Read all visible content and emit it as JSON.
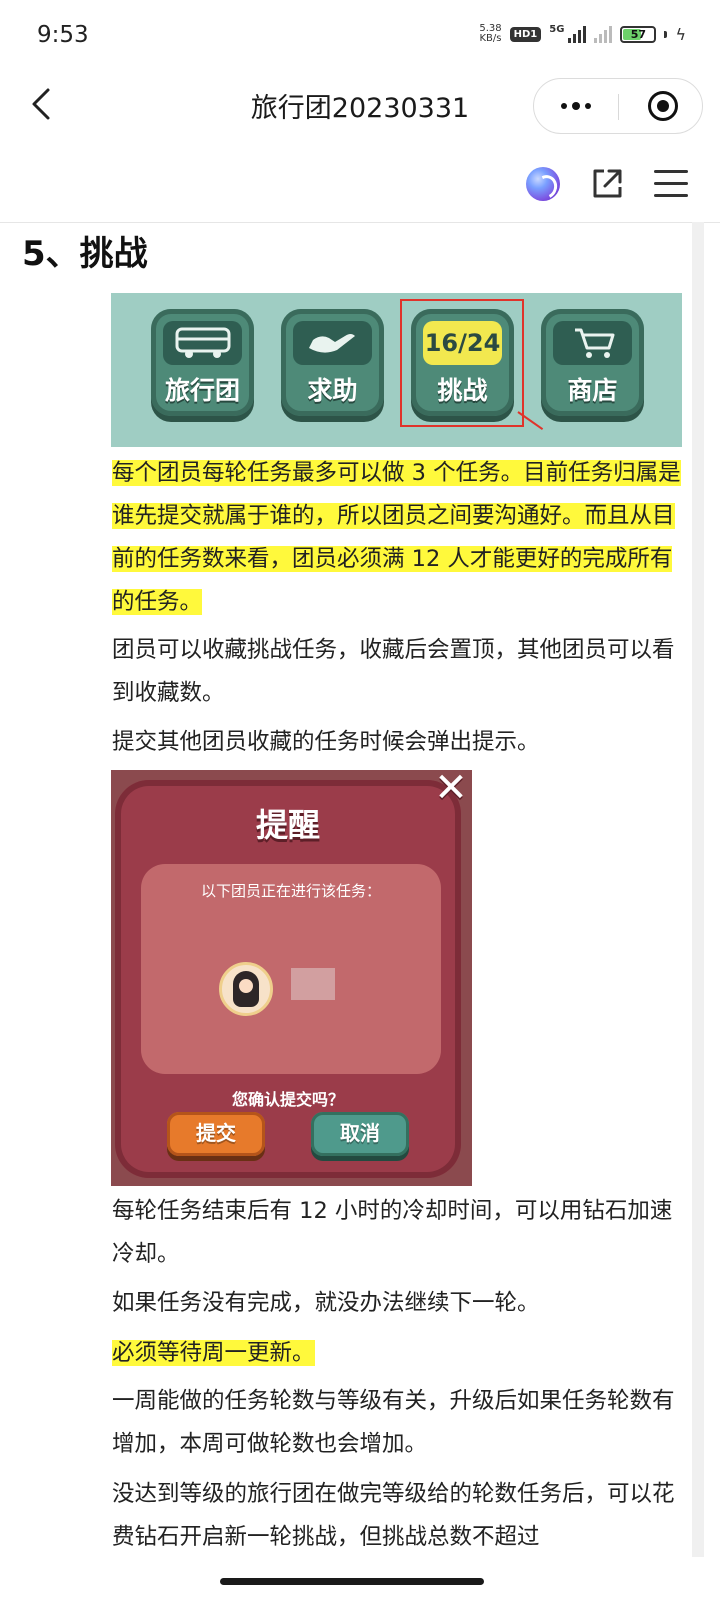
{
  "status_bar": {
    "time": "9:53",
    "net_speed_value": "5.38",
    "net_speed_unit": "KB/s",
    "hd_badge": "HD1",
    "network_type": "5G",
    "battery_percent": 57
  },
  "nav": {
    "title": "旅行团20230331"
  },
  "article": {
    "section_heading": "5、挑战",
    "banner": {
      "tiles": [
        {
          "label": "旅行团",
          "icon": "bus"
        },
        {
          "label": "求助",
          "icon": "hand"
        },
        {
          "label": "挑战",
          "counter": "16/24"
        },
        {
          "label": "商店",
          "icon": "cart"
        }
      ]
    },
    "highlight_paragraph": "每个团员每轮任务最多可以做 3 个任务。目前任务归属是谁先提交就属于谁的，所以团员之间要沟通好。而且从目前的任务数来看，团员必须满 12 人才能更好的完成所有的任务。",
    "p_favorite": "团员可以收藏挑战任务，收藏后会置顶，其他团员可以看到收藏数。",
    "p_submit_prompt": "提交其他团员收藏的任务时候会弹出提示。",
    "dialog": {
      "title": "提醒",
      "close_glyph": "✕",
      "message": "以下团员正在进行该任务：",
      "question": "您确认提交吗？",
      "submit_label": "提交",
      "cancel_label": "取消"
    },
    "p_cooldown": "每轮任务结束后有 12 小时的冷却时间，可以用钻石加速冷却。",
    "p_no_complete": "如果任务没有完成，就没办法继续下一轮。",
    "p_wait_monday": "必须等待周一更新。",
    "p_rounds_level": "一周能做的任务轮数与等级有关，升级后如果任务轮数有增加，本周可做轮数也会增加。",
    "p_not_reached": "没达到等级的旅行团在做完等级给的轮数任务后，可以花费钻石开启新一轮挑战，但挑战总数不超过"
  },
  "colors": {
    "highlight": "#fff93c",
    "banner_bg": "#9fcdc3",
    "dialog_bg": "#9b3c4a"
  }
}
